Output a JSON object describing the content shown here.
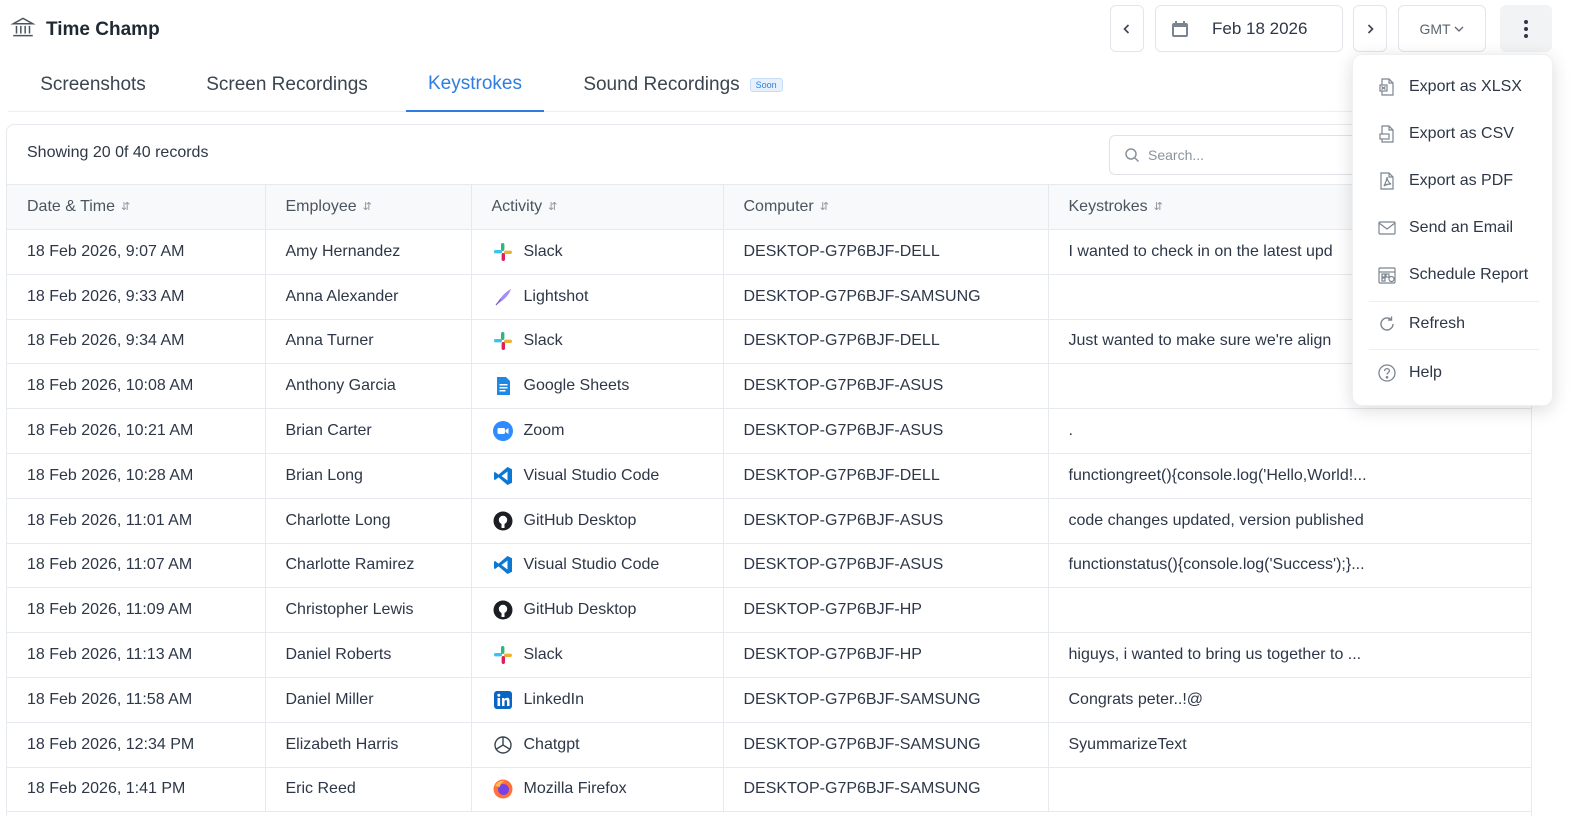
{
  "app": {
    "title": "Time Champ",
    "logo_icon": "bank-icon"
  },
  "header": {
    "date": "Feb 18 2026",
    "timezone": "GMT",
    "prev_icon": "chevron-left-icon",
    "next_icon": "chevron-right-icon",
    "more_icon": "kebab-icon"
  },
  "tabs": [
    {
      "label": "Screenshots",
      "active": false
    },
    {
      "label": "Screen Recordings",
      "active": false
    },
    {
      "label": "Keystrokes",
      "active": true
    },
    {
      "label": "Sound Recordings",
      "active": false,
      "badge": "Soon"
    }
  ],
  "table": {
    "records_text": "Showing 20 0f 40 records",
    "search_placeholder": "Search...",
    "columns": [
      "Date & Time",
      "Employee",
      "Activity",
      "Computer",
      "Keystrokes"
    ],
    "rows": [
      {
        "datetime": "18 Feb 2026, 9:07 AM",
        "employee": "Amy Hernandez",
        "activity": "Slack",
        "icon": "slack-icon",
        "computer": "DESKTOP-G7P6BJF-DELL",
        "keystrokes": "I wanted to check in on the latest upd"
      },
      {
        "datetime": "18 Feb 2026, 9:33 AM",
        "employee": "Anna Alexander",
        "activity": "Lightshot",
        "icon": "lightshot-icon",
        "computer": "DESKTOP-G7P6BJF-SAMSUNG",
        "keystrokes": ""
      },
      {
        "datetime": "18 Feb 2026, 9:34 AM",
        "employee": "Anna Turner",
        "activity": "Slack",
        "icon": "slack-icon",
        "computer": "DESKTOP-G7P6BJF-DELL",
        "keystrokes": "Just wanted to make sure we're align"
      },
      {
        "datetime": "18 Feb 2026, 10:08 AM",
        "employee": "Anthony Garcia",
        "activity": "Google Sheets",
        "icon": "google-sheets-icon",
        "computer": "DESKTOP-G7P6BJF-ASUS",
        "keystrokes": ""
      },
      {
        "datetime": "18 Feb 2026, 10:21 AM",
        "employee": "Brian Carter",
        "activity": "Zoom",
        "icon": "zoom-icon",
        "computer": "DESKTOP-G7P6BJF-ASUS",
        "keystrokes": "."
      },
      {
        "datetime": "18 Feb 2026, 10:28 AM",
        "employee": "Brian Long",
        "activity": "Visual Studio Code",
        "icon": "vscode-icon",
        "computer": "DESKTOP-G7P6BJF-DELL",
        "keystrokes": "functiongreet(){console.log('Hello,World!..."
      },
      {
        "datetime": "18 Feb 2026, 11:01 AM",
        "employee": "Charlotte Long",
        "activity": "GitHub Desktop",
        "icon": "github-icon",
        "computer": "DESKTOP-G7P6BJF-ASUS",
        "keystrokes": "code changes updated, version published"
      },
      {
        "datetime": "18 Feb 2026, 11:07 AM",
        "employee": "Charlotte Ramirez",
        "activity": "Visual Studio Code",
        "icon": "vscode-icon",
        "computer": "DESKTOP-G7P6BJF-ASUS",
        "keystrokes": "functionstatus(){console.log('Success');}..."
      },
      {
        "datetime": "18 Feb 2026, 11:09 AM",
        "employee": "Christopher Lewis",
        "activity": "GitHub Desktop",
        "icon": "github-icon",
        "computer": "DESKTOP-G7P6BJF-HP",
        "keystrokes": ""
      },
      {
        "datetime": "18 Feb 2026, 11:13 AM",
        "employee": "Daniel Roberts",
        "activity": "Slack",
        "icon": "slack-icon",
        "computer": "DESKTOP-G7P6BJF-HP",
        "keystrokes": "higuys, i wanted to bring us together to ..."
      },
      {
        "datetime": "18 Feb 2026, 11:58 AM",
        "employee": "Daniel Miller",
        "activity": "LinkedIn",
        "icon": "linkedin-icon",
        "computer": "DESKTOP-G7P6BJF-SAMSUNG",
        "keystrokes": "Congrats peter..!@"
      },
      {
        "datetime": "18 Feb 2026, 12:34 PM",
        "employee": "Elizabeth Harris",
        "activity": "Chatgpt",
        "icon": "chatgpt-icon",
        "computer": "DESKTOP-G7P6BJF-SAMSUNG",
        "keystrokes": "SyummarizeText"
      },
      {
        "datetime": "18 Feb 2026, 1:41 PM",
        "employee": "Eric Reed",
        "activity": "Mozilla Firefox",
        "icon": "firefox-icon",
        "computer": "DESKTOP-G7P6BJF-SAMSUNG",
        "keystrokes": ""
      }
    ]
  },
  "menu": {
    "items": [
      {
        "label": "Export as XLSX",
        "icon": "xlsx-file-icon"
      },
      {
        "label": "Export as CSV",
        "icon": "csv-file-icon"
      },
      {
        "label": "Export as PDF",
        "icon": "pdf-file-icon"
      },
      {
        "label": "Send an Email",
        "icon": "mail-icon"
      },
      {
        "label": "Schedule Report",
        "icon": "calendar-report-icon"
      },
      {
        "label": "Refresh",
        "icon": "refresh-icon"
      },
      {
        "label": "Help",
        "icon": "help-icon"
      }
    ]
  },
  "colors": {
    "accent": "#2f7de1",
    "border": "#e6e9ed"
  }
}
